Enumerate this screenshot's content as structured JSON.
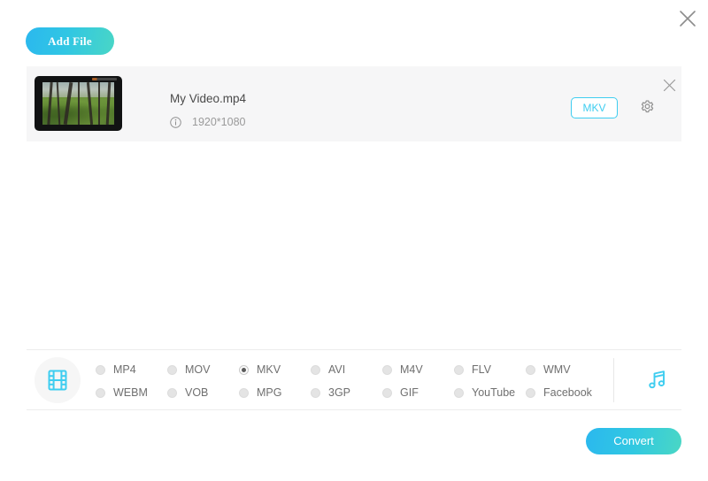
{
  "window": {
    "close_icon": "close-icon"
  },
  "toolbar": {
    "add_file_label": "Add File"
  },
  "file_row": {
    "name": "My Video.mp4",
    "resolution": "1920*1080",
    "info_icon": "info-icon",
    "format_badge": "MKV",
    "settings_icon": "gear-icon",
    "remove_icon": "close-icon",
    "thumbnail_alt": "forest video frame"
  },
  "format_panel": {
    "video_icon": "film-icon",
    "audio_icon": "music-note-icon",
    "selected": "MKV",
    "options": [
      {
        "label": "MP4",
        "selected": false
      },
      {
        "label": "MOV",
        "selected": false
      },
      {
        "label": "MKV",
        "selected": true
      },
      {
        "label": "AVI",
        "selected": false
      },
      {
        "label": "M4V",
        "selected": false
      },
      {
        "label": "FLV",
        "selected": false
      },
      {
        "label": "WMV",
        "selected": false
      },
      {
        "label": "WEBM",
        "selected": false
      },
      {
        "label": "VOB",
        "selected": false
      },
      {
        "label": "MPG",
        "selected": false
      },
      {
        "label": "3GP",
        "selected": false
      },
      {
        "label": "GIF",
        "selected": false
      },
      {
        "label": "YouTube",
        "selected": false
      },
      {
        "label": "Facebook",
        "selected": false
      }
    ]
  },
  "footer": {
    "convert_label": "Convert"
  },
  "colors": {
    "accent_start": "#2bb8ee",
    "accent_end": "#4ad7c4",
    "icon_cyan": "#3ecdf0",
    "row_bg": "#f6f6f7",
    "text_primary": "#4a4a4a",
    "text_secondary": "#9a9a9a"
  }
}
